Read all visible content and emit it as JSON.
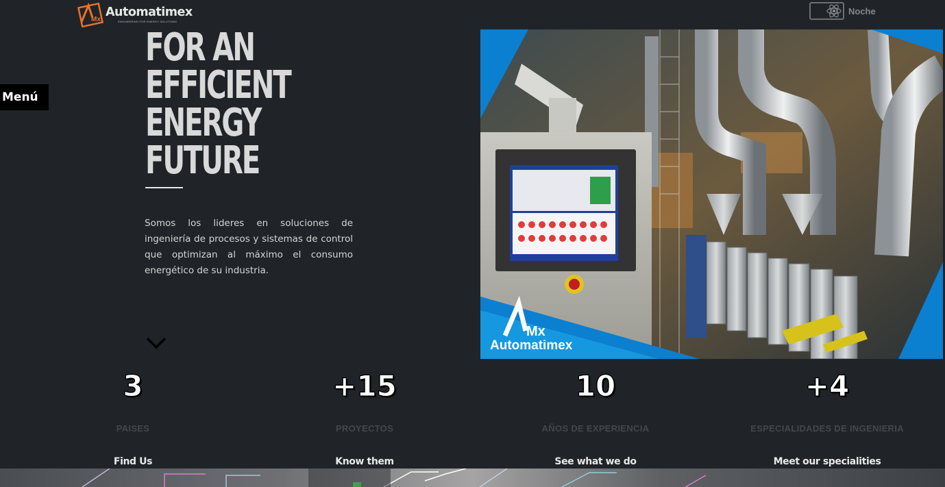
{
  "header": {
    "logo_text": "Automatimex",
    "logo_tagline": "ENGINEERING FOR ENERGY SOLUTIONS",
    "mode_label": "Noche",
    "mode_icon": "atom-icon"
  },
  "menu": {
    "label": "Menú"
  },
  "hero": {
    "title_lines": [
      "FOR AN",
      "EFFICIENT",
      "ENERGY",
      "FUTURE"
    ],
    "description": "Somos los lideres en soluciones de ingeniería de procesos y sistemas de control que optimizan al máximo el consumo energético de su industria.",
    "scroll_icon": "chevron-down-icon",
    "image_brand": "Automatimex",
    "image_brand_mark": "Mx"
  },
  "stats": [
    {
      "number": "3",
      "label": "PAISES",
      "link": "Find Us"
    },
    {
      "number": "+15",
      "label": "PROYECTOS",
      "link": "Know them"
    },
    {
      "number": "10",
      "label": "AÑOS DE EXPERIENCIA",
      "link": "See what we do"
    },
    {
      "number": "+4",
      "label": "ESPECIALIDADES DE INGENIERIA",
      "link": "Meet our specialities"
    }
  ],
  "colors": {
    "background": "#202428",
    "logo_accent": "#e8722c",
    "image_accent": "#0b7fd0",
    "stat_label": "#44484c"
  }
}
